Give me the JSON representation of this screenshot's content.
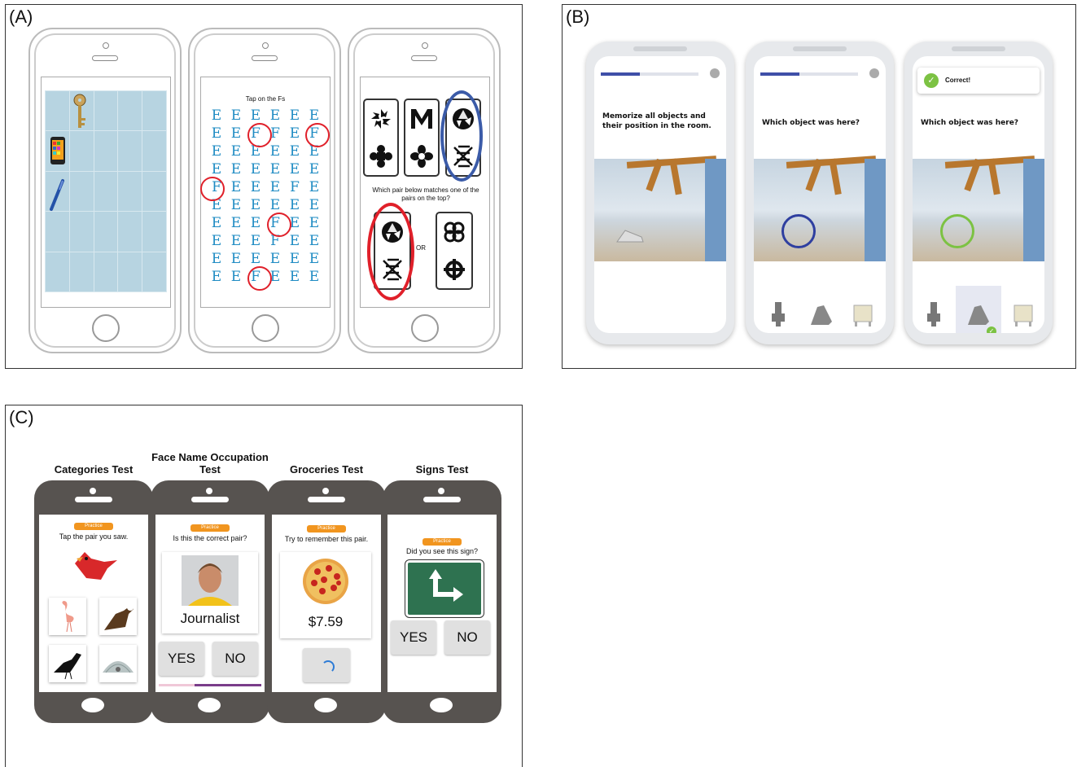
{
  "panels": {
    "a": {
      "label": "(A)",
      "phone2": {
        "instruction": "Tap on the Fs",
        "rows": [
          [
            "E",
            "E",
            "E",
            "E",
            "E",
            "E"
          ],
          [
            "E",
            "E",
            "F",
            "F",
            "E",
            "F"
          ],
          [
            "E",
            "E",
            "E",
            "E",
            "E",
            "E"
          ],
          [
            "E",
            "E",
            "E",
            "E",
            "E",
            "E"
          ],
          [
            "F",
            "E",
            "E",
            "E",
            "F",
            "E"
          ],
          [
            "E",
            "E",
            "E",
            "E",
            "E",
            "E"
          ],
          [
            "E",
            "E",
            "E",
            "F",
            "E",
            "E"
          ],
          [
            "E",
            "E",
            "E",
            "F",
            "E",
            "E"
          ],
          [
            "E",
            "E",
            "E",
            "E",
            "E",
            "E"
          ],
          [
            "E",
            "E",
            "F",
            "E",
            "E",
            "E"
          ]
        ]
      },
      "phone3": {
        "question": "Which pair below matches one of the pairs on the top?",
        "or_label": "OR"
      }
    },
    "b": {
      "label": "(B)",
      "phone1": {
        "question": "Memorize all objects and their position in the room."
      },
      "phone2": {
        "question": "Which object was here?"
      },
      "phone3": {
        "question": "Which object was here?",
        "feedback": "Correct!"
      },
      "colors": {
        "progress": "#3f4fa8",
        "selection_blue": "#2f3fa0",
        "selection_green": "#7cc243"
      }
    },
    "c": {
      "label": "(C)",
      "tests": [
        {
          "title": "Categories Test",
          "badge": "Practice",
          "question": "Tap the pair you saw."
        },
        {
          "title": "Face Name Occupation Test",
          "badge": "Practice",
          "question": "Is this the correct pair?",
          "occupation": "Journalist",
          "yes": "YES",
          "no": "NO"
        },
        {
          "title": "Groceries Test",
          "badge": "Practice",
          "question": "Try to remember this pair.",
          "price": "$7.59"
        },
        {
          "title": "Signs Test",
          "badge": "Practice",
          "question": "Did you see this sign?",
          "yes": "YES",
          "no": "NO"
        }
      ],
      "colors": {
        "badge": "#f1951f",
        "phone_body": "#575350",
        "sign_green": "#2e7250"
      }
    }
  }
}
